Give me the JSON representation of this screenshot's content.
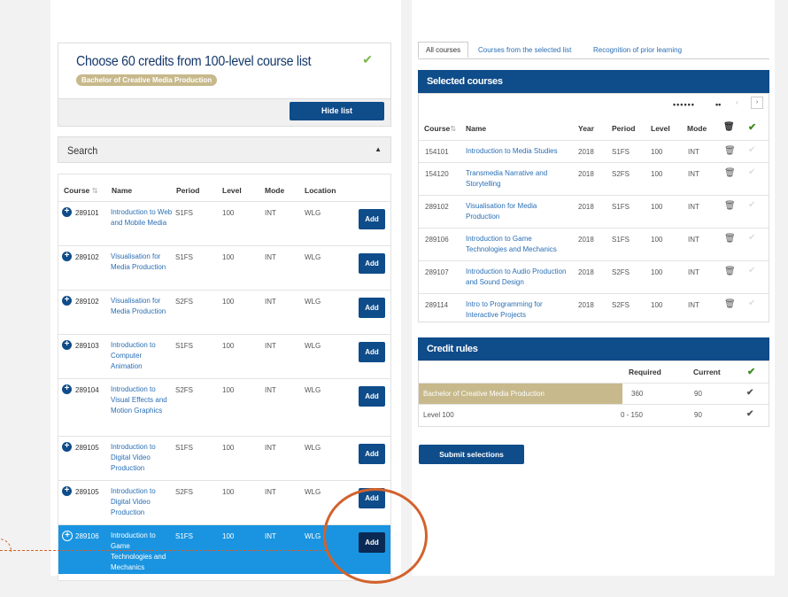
{
  "left": {
    "title": "Choose 60 credits from 100-level course list",
    "badge": "Bachelor of Creative Media Production",
    "hide_button": "Hide list",
    "search_label": "Search",
    "columns": [
      "Course",
      "Name",
      "Period",
      "Level",
      "Mode",
      "Location"
    ],
    "add_label": "Add",
    "rows": [
      {
        "code": "289101",
        "name": "Introduction to Web and Mobile Media",
        "period": "S1FS",
        "level": "100",
        "mode": "INT",
        "location": "WLG"
      },
      {
        "code": "289102",
        "name": "Visualisation for Media Production",
        "period": "S1FS",
        "level": "100",
        "mode": "INT",
        "location": "WLG"
      },
      {
        "code": "289102",
        "name": "Visualisation for Media Production",
        "period": "S2FS",
        "level": "100",
        "mode": "INT",
        "location": "WLG"
      },
      {
        "code": "289103",
        "name": "Introduction to Computer Animation",
        "period": "S1FS",
        "level": "100",
        "mode": "INT",
        "location": "WLG"
      },
      {
        "code": "289104",
        "name": "Introduction to Visual Effects and Motion Graphics",
        "period": "S2FS",
        "level": "100",
        "mode": "INT",
        "location": "WLG"
      },
      {
        "code": "289105",
        "name": "Introduction to Digital Video Production",
        "period": "S1FS",
        "level": "100",
        "mode": "INT",
        "location": "WLG"
      },
      {
        "code": "289105",
        "name": "Introduction to Digital Video Production",
        "period": "S2FS",
        "level": "100",
        "mode": "INT",
        "location": "WLG"
      },
      {
        "code": "289106",
        "name": "Introduction to Game Technologies and Mechanics",
        "period": "S1FS",
        "level": "100",
        "mode": "INT",
        "location": "WLG"
      }
    ]
  },
  "right": {
    "tabs": [
      "All courses",
      "Courses from the selected list",
      "Recognition of prior learning"
    ],
    "selected_title": "Selected courses",
    "pager_dots": "••••••",
    "pager_dots2": "••",
    "pager_prev": "‹",
    "pager_next": "›",
    "selected_columns": [
      "Course",
      "Name",
      "Year",
      "Period",
      "Level",
      "Mode"
    ],
    "trash_glyph": "🗑",
    "check_glyph": "✔",
    "sort_glyph": "⇅",
    "selected_rows": [
      {
        "code": "154101",
        "name": "Introduction to Media Studies",
        "year": "2018",
        "period": "S1FS",
        "level": "100",
        "mode": "INT"
      },
      {
        "code": "154120",
        "name": "Transmedia Narrative and Storytelling",
        "year": "2018",
        "period": "S2FS",
        "level": "100",
        "mode": "INT"
      },
      {
        "code": "289102",
        "name": "Visualisation for Media Production",
        "year": "2018",
        "period": "S1FS",
        "level": "100",
        "mode": "INT"
      },
      {
        "code": "289106",
        "name": "Introduction to Game Technologies and Mechanics",
        "year": "2018",
        "period": "S1FS",
        "level": "100",
        "mode": "INT"
      },
      {
        "code": "289107",
        "name": "Introduction to Audio Production and Sound Design",
        "year": "2018",
        "period": "S2FS",
        "level": "100",
        "mode": "INT"
      },
      {
        "code": "289114",
        "name": "Intro to Programming for Interactive Projects",
        "year": "2018",
        "period": "S2FS",
        "level": "100",
        "mode": "INT"
      }
    ],
    "credit_title": "Credit rules",
    "credit_columns": {
      "required": "Required",
      "current": "Current"
    },
    "credit_rows": [
      {
        "rule": "Bachelor of Creative Media Production",
        "required": "360",
        "current": "90"
      },
      {
        "rule": "Level 100",
        "required": "0 - 150",
        "current": "90"
      }
    ],
    "submit_button": "Submit selections"
  },
  "colors": {
    "primary": "#0f4c8a",
    "highlight": "#1a94e0",
    "tan": "#c7b98b",
    "annotation": "#d2622c",
    "check_green": "#3b8a1e"
  }
}
